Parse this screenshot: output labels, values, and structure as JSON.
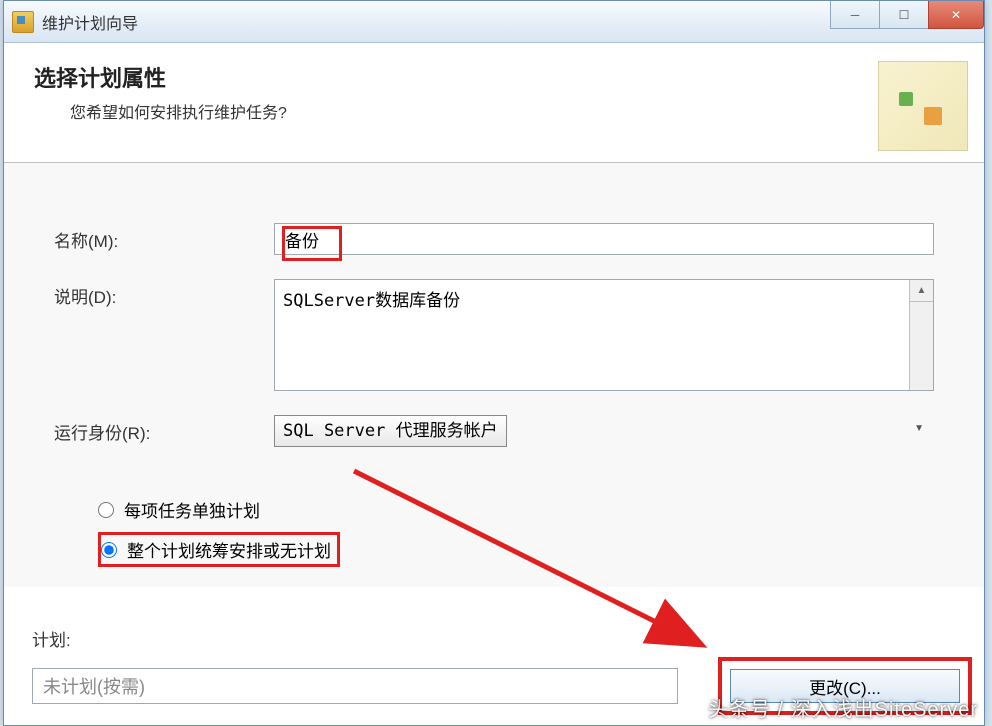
{
  "window": {
    "title": "维护计划向导"
  },
  "header": {
    "title": "选择计划属性",
    "subtitle": "您希望如何安排执行维护任务?"
  },
  "form": {
    "name_label": "名称(M):",
    "name_value": "备份",
    "desc_label": "说明(D):",
    "desc_value": "SQLServer数据库备份",
    "runas_label": "运行身份(R):",
    "runas_value": "SQL Server 代理服务帐户"
  },
  "radios": {
    "option1": "每项任务单独计划",
    "option2": "整个计划统筹安排或无计划"
  },
  "plan": {
    "label": "计划:",
    "value": "未计划(按需)",
    "change_button": "更改(C)..."
  },
  "watermark": "头条号 / 深入浅出SiteServer"
}
